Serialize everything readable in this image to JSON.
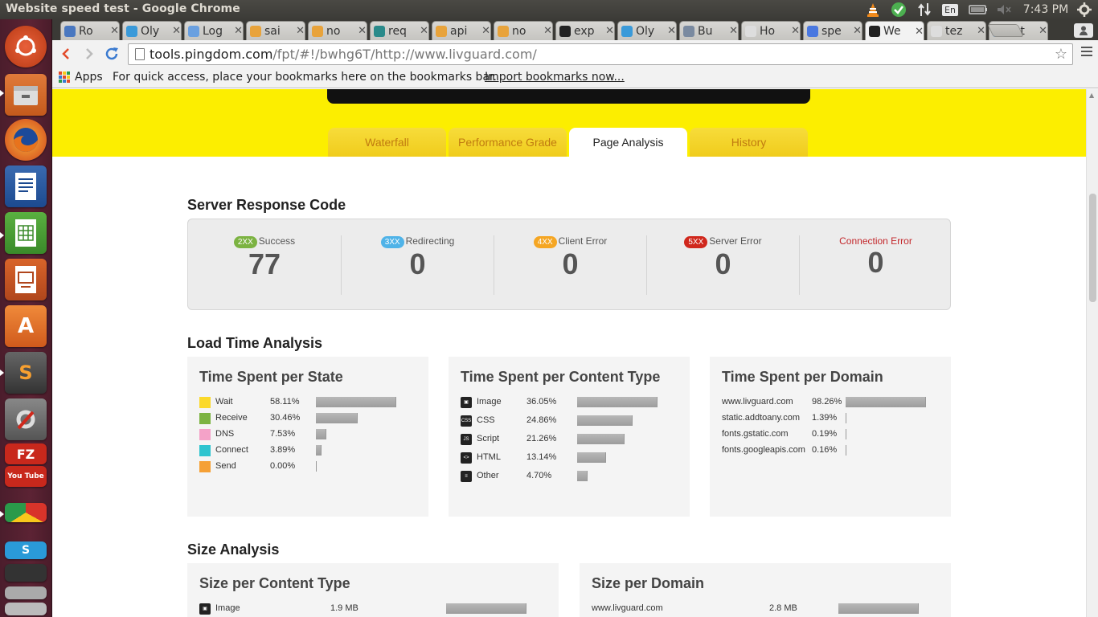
{
  "window": {
    "title": "Website speed test - Google Chrome"
  },
  "panel": {
    "clock": "7:43 PM",
    "language": "En"
  },
  "tabs": [
    {
      "label": "Ro",
      "color": "#4a78c0"
    },
    {
      "label": "Oly",
      "color": "#3a9ad9"
    },
    {
      "label": "Log",
      "color": "#6aa0e0"
    },
    {
      "label": "sai",
      "color": "#e8a33b"
    },
    {
      "label": "no",
      "color": "#e8a33b"
    },
    {
      "label": "req",
      "color": "#2a8a8a"
    },
    {
      "label": "api",
      "color": "#e8a33b"
    },
    {
      "label": "no",
      "color": "#e8a33b"
    },
    {
      "label": "exp",
      "color": "#222222"
    },
    {
      "label": "Oly",
      "color": "#3a9ad9"
    },
    {
      "label": "Bu",
      "color": "#7a8aa0"
    },
    {
      "label": "Ho",
      "color": "#dddddd"
    },
    {
      "label": "spe",
      "color": "#4a78e0"
    },
    {
      "label": "We",
      "color": "#222222"
    },
    {
      "label": "tez",
      "color": "#dddddd"
    },
    {
      "label": "Lat",
      "color": "#6a9ad9"
    }
  ],
  "active_tab_index": 13,
  "address": {
    "host": "tools.pingdom.com",
    "path": "/fpt/#!/bwhg6T/http://www.livguard.com/"
  },
  "bookmarks": {
    "apps": "Apps",
    "hint": "For quick access, place your bookmarks here on the bookmarks bar.",
    "import": "Import bookmarks now..."
  },
  "page_tabs": [
    "Waterfall",
    "Performance Grade",
    "Page Analysis",
    "History"
  ],
  "active_page_tab": "Page Analysis",
  "server_response": {
    "title": "Server Response Code",
    "columns": [
      {
        "badge": "2XX",
        "label": "Success",
        "value": "77",
        "color": "#7cb342"
      },
      {
        "badge": "3XX",
        "label": "Redirecting",
        "value": "0",
        "color": "#4fb3e8"
      },
      {
        "badge": "4XX",
        "label": "Client Error",
        "value": "0",
        "color": "#f5a623"
      },
      {
        "badge": "5XX",
        "label": "Server Error",
        "value": "0",
        "color": "#d0271c"
      },
      {
        "badge": "",
        "label": "Connection Error",
        "value": "0",
        "color": "#c3272b"
      }
    ]
  },
  "load_time": {
    "title": "Load Time Analysis",
    "per_state": {
      "title": "Time Spent per State",
      "rows": [
        {
          "label": "Wait",
          "pct": "58.11%",
          "value": 58.11,
          "color": "#fbd92a"
        },
        {
          "label": "Receive",
          "pct": "30.46%",
          "value": 30.46,
          "color": "#7cb342"
        },
        {
          "label": "DNS",
          "pct": "7.53%",
          "value": 7.53,
          "color": "#f4a2c8"
        },
        {
          "label": "Connect",
          "pct": "3.89%",
          "value": 3.89,
          "color": "#2ec4cf"
        },
        {
          "label": "Send",
          "pct": "0.00%",
          "value": 0.0,
          "color": "#f5a035"
        }
      ]
    },
    "per_content_type": {
      "title": "Time Spent per Content Type",
      "rows": [
        {
          "label": "Image",
          "pct": "36.05%",
          "value": 36.05,
          "icon": "image-icon"
        },
        {
          "label": "CSS",
          "pct": "24.86%",
          "value": 24.86,
          "icon": "css-icon"
        },
        {
          "label": "Script",
          "pct": "21.26%",
          "value": 21.26,
          "icon": "script-icon"
        },
        {
          "label": "HTML",
          "pct": "13.14%",
          "value": 13.14,
          "icon": "html-icon"
        },
        {
          "label": "Other",
          "pct": "4.70%",
          "value": 4.7,
          "icon": "other-icon"
        }
      ]
    },
    "per_domain": {
      "title": "Time Spent per Domain",
      "rows": [
        {
          "label": "www.livguard.com",
          "pct": "98.26%",
          "value": 98.26
        },
        {
          "label": "static.addtoany.com",
          "pct": "1.39%",
          "value": 1.39
        },
        {
          "label": "fonts.gstatic.com",
          "pct": "0.19%",
          "value": 0.19
        },
        {
          "label": "fonts.googleapis.com",
          "pct": "0.16%",
          "value": 0.16
        }
      ]
    }
  },
  "size_analysis": {
    "title": "Size Analysis",
    "per_content_type": {
      "title": "Size per Content Type",
      "rows": [
        {
          "label": "Image",
          "size": "1.9 MB",
          "value": 1.9
        }
      ]
    },
    "per_domain": {
      "title": "Size per Domain",
      "rows": [
        {
          "label": "www.livguard.com",
          "size": "2.8 MB",
          "value": 2.8
        }
      ]
    }
  }
}
